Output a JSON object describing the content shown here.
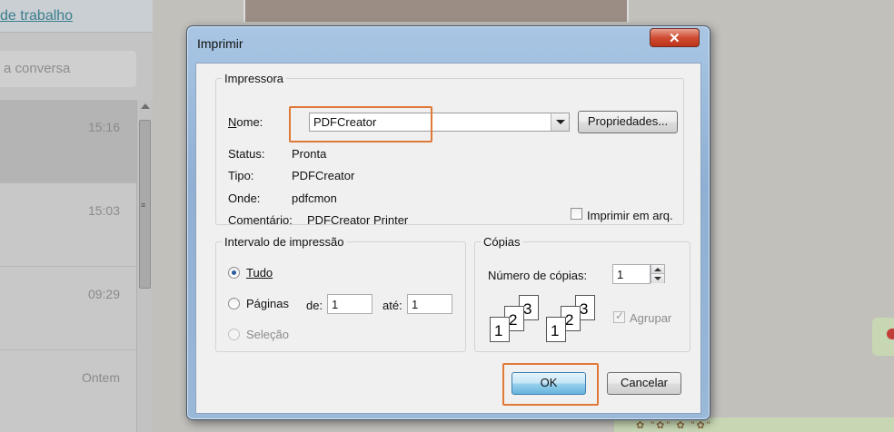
{
  "background": {
    "link_text": "de trabalho",
    "search_placeholder": "a conversa",
    "chat_times": [
      "15:16",
      "15:03",
      "09:29",
      "Ontem"
    ]
  },
  "dialog": {
    "title": "Imprimir",
    "close_icon": "close-icon",
    "printer_group": {
      "legend": "Impressora",
      "name_label": "Nome:",
      "name_value": "PDFCreator",
      "properties_button": "Propriedades...",
      "status_label": "Status:",
      "status_value": "Pronta",
      "type_label": "Tipo:",
      "type_value": "PDFCreator",
      "where_label": "Onde:",
      "where_value": "pdfcmon",
      "comment_label": "Comentário:",
      "comment_value": "PDFCreator Printer",
      "print_to_file_label": "Imprimir em arq.",
      "print_to_file_checked": false
    },
    "range_group": {
      "legend": "Intervalo de impressão",
      "all_label": "Tudo",
      "all_selected": true,
      "pages_label": "Páginas",
      "from_label": "de:",
      "from_value": "1",
      "to_label": "até:",
      "to_value": "1",
      "selection_label": "Seleção",
      "selection_enabled": false
    },
    "copies_group": {
      "legend": "Cópias",
      "count_label": "Número de cópias:",
      "count_value": "1",
      "collate_label": "Agrupar",
      "collate_checked": true,
      "collate_enabled": false,
      "collate_pages": [
        "1",
        "2",
        "3",
        "1",
        "2",
        "3"
      ]
    },
    "ok_button": "OK",
    "cancel_button": "Cancelar",
    "highlight_color": "#e07838"
  }
}
